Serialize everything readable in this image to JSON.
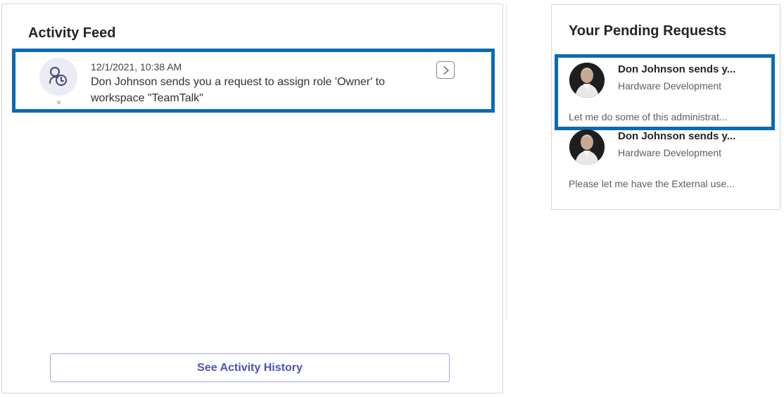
{
  "activity_feed": {
    "title": "Activity Feed",
    "item": {
      "timestamp": "12/1/2021, 10:38 AM",
      "message": "Don Johnson sends you a request to assign role 'Owner' to workspace \"TeamTalk\"",
      "icon": "user-role-request-icon"
    },
    "history_button_label": "See Activity History"
  },
  "pending_requests": {
    "title": "Your Pending Requests",
    "items": [
      {
        "name": "Don Johnson sends y...",
        "department": "Hardware Development",
        "message": "Let me do some of this administrat..."
      },
      {
        "name": "Don Johnson sends y...",
        "department": "Hardware Development",
        "message": "Please let me have the External use..."
      }
    ]
  },
  "colors": {
    "highlight": "#0b6ab3",
    "accent": "#4f52b2"
  }
}
